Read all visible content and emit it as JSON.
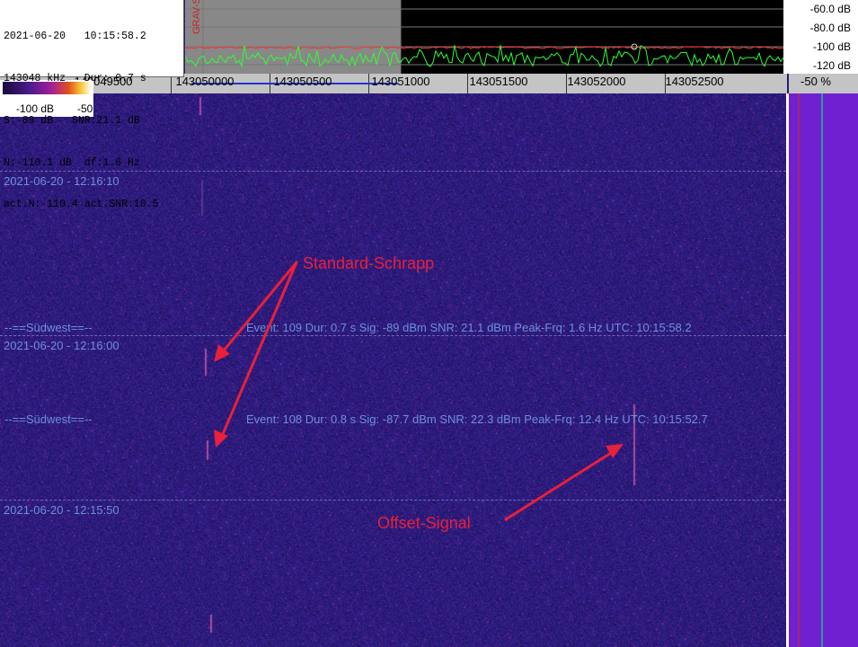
{
  "info": {
    "lines": [
      "2021-06-20   10:15:58.2",
      "143048 kHz   Dur: 0.7 s",
      "S:-89 dB   SNR:21.1 dB",
      "N:-110.1 dB  df:1.6 Hz",
      "act.N:-110.4 act.SNR:10.5"
    ]
  },
  "spectrum": {
    "vertical_label": "GRAV-SW",
    "db_labels": [
      "-60.0 dB",
      "-80.0 dB",
      "-100 dB",
      "-120 dB"
    ]
  },
  "freq_axis": {
    "labels": [
      "143049500",
      "143050000",
      "143050500",
      "143051000",
      "143051500",
      "143052000",
      "143052500"
    ],
    "percent": "-50 %"
  },
  "colorbar": {
    "min_label": "-100 dB",
    "max_label": "-50"
  },
  "timestamps": [
    "2021-06-20 - 12:16:10",
    "2021-06-20 - 12:16:00",
    "2021-06-20 - 12:15:50"
  ],
  "events": [
    {
      "station": "--==Südwest==--",
      "text": "Event: 109   Dur: 0.7 s   Sig: -89 dBm   SNR: 21.1 dBm   Peak-Frq: 1.6 Hz   UTC: 10:15:58.2"
    },
    {
      "station": "--==Südwest==--",
      "text": "Event: 108   Dur: 0.8 s   Sig: -87.7 dBm   SNR: 22.3 dBm   Peak-Frq: 12.4 Hz   UTC: 10:15:52.7"
    }
  ],
  "annotations": {
    "standard": "Standard-Schrapp",
    "offset": "Offset-Signal"
  },
  "colors": {
    "annotation": "#e8203a",
    "overlay_text": "#6f8fd8",
    "spectrum_trace": "#30ff30",
    "noise_floor_trace": "#ff3030"
  }
}
